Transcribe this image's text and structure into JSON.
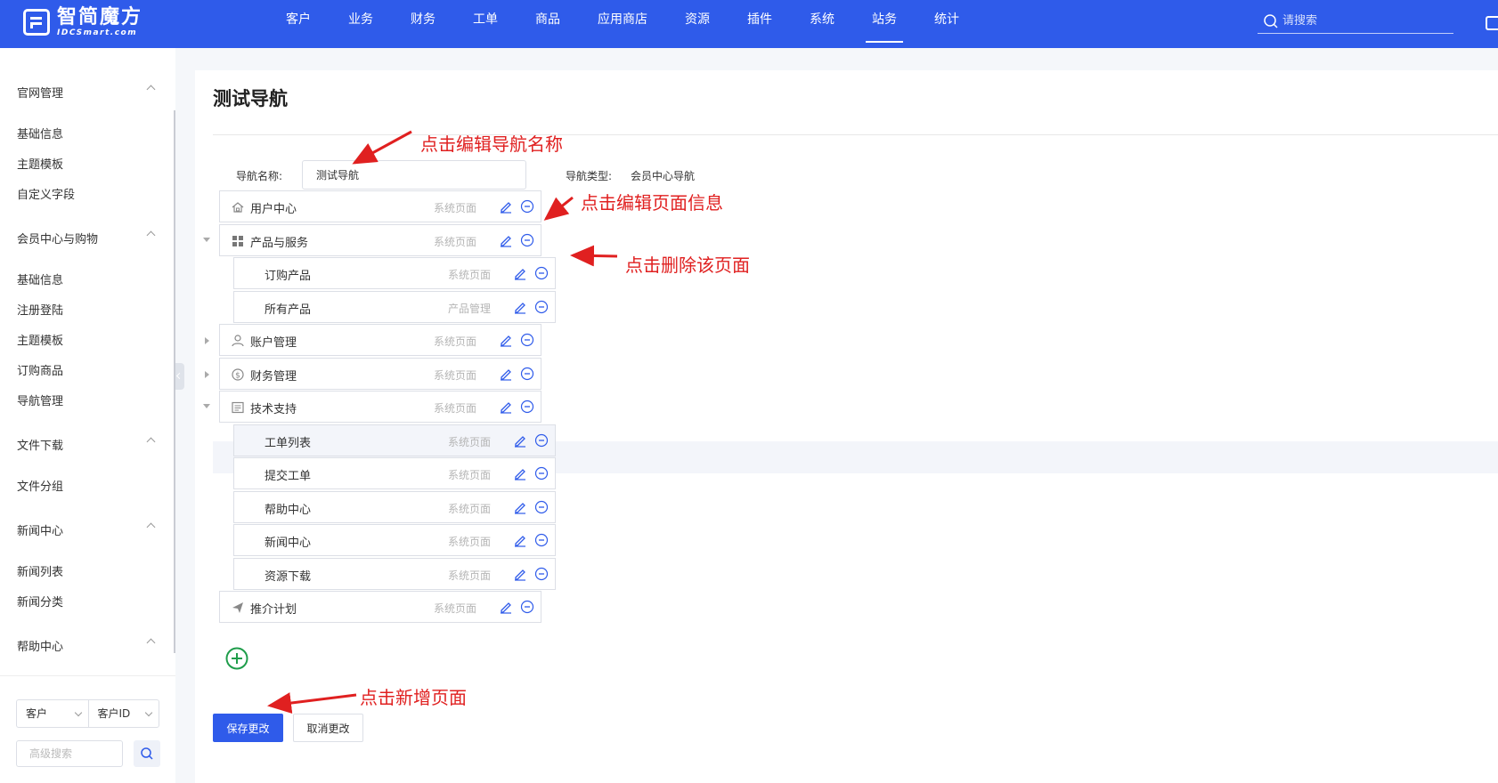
{
  "header": {
    "logo_name": "智简魔方",
    "logo_sub": "IDCSmart.com",
    "nav": [
      "客户",
      "业务",
      "财务",
      "工单",
      "商品",
      "应用商店",
      "资源",
      "插件",
      "系统",
      "站务",
      "统计"
    ],
    "active_nav": "站务",
    "search_placeholder": "请搜索"
  },
  "sidebar": {
    "groups": [
      {
        "title": "官网管理",
        "items": [
          "基础信息",
          "主题模板",
          "自定义字段"
        ]
      },
      {
        "title": "会员中心与购物",
        "items": [
          "基础信息",
          "注册登陆",
          "主题模板",
          "订购商品",
          "导航管理"
        ]
      },
      {
        "title": "文件下载",
        "items": [
          "文件分组"
        ]
      },
      {
        "title": "新闻中心",
        "items": [
          "新闻列表",
          "新闻分类"
        ]
      },
      {
        "title": "帮助中心",
        "items": []
      }
    ],
    "select_1": "客户",
    "select_2": "客户ID",
    "adv_search_placeholder": "高级搜索"
  },
  "main": {
    "title": "测试导航",
    "name_label": "导航名称:",
    "name_value": "测试导航",
    "type_label": "导航类型:",
    "type_value": "会员中心导航",
    "rows": [
      {
        "name": "用户中心",
        "type": "系统页面",
        "icon": "home-icon",
        "level": 0,
        "expander": ""
      },
      {
        "name": "产品与服务",
        "type": "系统页面",
        "icon": "grid-icon",
        "level": 0,
        "expander": "open"
      },
      {
        "name": "订购产品",
        "type": "系统页面",
        "icon": "",
        "level": 1,
        "expander": ""
      },
      {
        "name": "所有产品",
        "type": "产品管理",
        "icon": "",
        "level": 1,
        "expander": ""
      },
      {
        "name": "账户管理",
        "type": "系统页面",
        "icon": "user-icon",
        "level": 0,
        "expander": "closed"
      },
      {
        "name": "财务管理",
        "type": "系统页面",
        "icon": "dollar-icon",
        "level": 0,
        "expander": "closed"
      },
      {
        "name": "技术支持",
        "type": "系统页面",
        "icon": "document-icon",
        "level": 0,
        "expander": "open"
      },
      {
        "name": "工单列表",
        "type": "系统页面",
        "icon": "",
        "level": 1,
        "expander": "",
        "highlight": true
      },
      {
        "name": "提交工单",
        "type": "系统页面",
        "icon": "",
        "level": 1,
        "expander": ""
      },
      {
        "name": "帮助中心",
        "type": "系统页面",
        "icon": "",
        "level": 1,
        "expander": ""
      },
      {
        "name": "新闻中心",
        "type": "系统页面",
        "icon": "",
        "level": 1,
        "expander": ""
      },
      {
        "name": "资源下载",
        "type": "系统页面",
        "icon": "",
        "level": 1,
        "expander": ""
      },
      {
        "name": "推介计划",
        "type": "系统页面",
        "icon": "send-icon",
        "level": 0,
        "expander": ""
      }
    ],
    "save_label": "保存更改",
    "cancel_label": "取消更改"
  },
  "annotations": {
    "edit_name": "点击编辑导航名称",
    "edit_page": "点击编辑页面信息",
    "delete_page": "点击删除该页面",
    "add_page": "点击新增页面"
  },
  "colors": {
    "brand": "#2f5bea",
    "annotation": "#e02020",
    "add": "#1f9d4b"
  }
}
